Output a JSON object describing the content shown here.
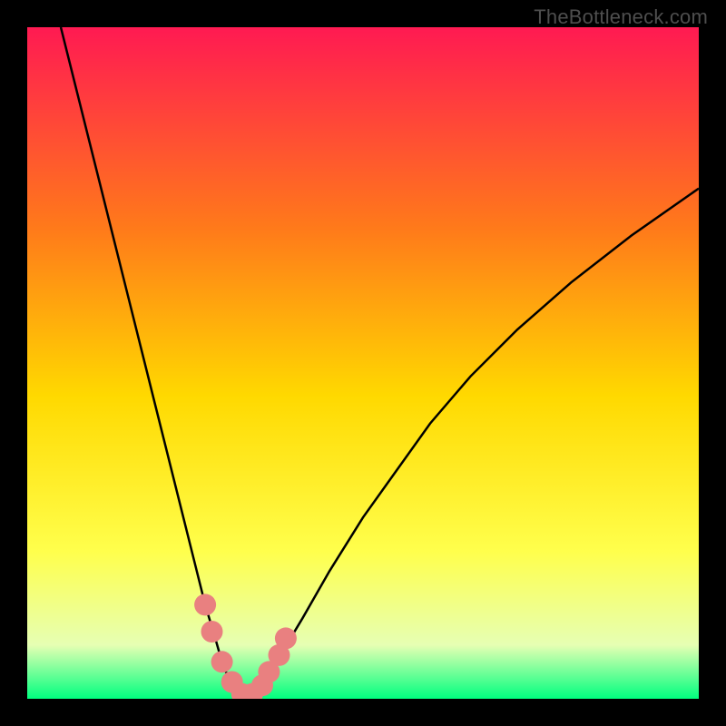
{
  "watermark": "TheBottleneck.com",
  "colors": {
    "gradient_top": "#ff1a52",
    "gradient_mid1": "#ff7a1a",
    "gradient_mid2": "#ffd900",
    "gradient_mid3": "#ffff4c",
    "gradient_mid4": "#e6ffb3",
    "gradient_bottom": "#00ff7f",
    "curve": "#000000",
    "marker": "#e98080",
    "frame": "#000000"
  },
  "chart_data": {
    "type": "line",
    "title": "",
    "xlabel": "",
    "ylabel": "",
    "xlim": [
      0,
      100
    ],
    "ylim": [
      0,
      100
    ],
    "series": [
      {
        "name": "bottleneck-curve",
        "x": [
          5,
          7,
          9,
          11,
          13,
          15,
          17,
          19,
          21,
          23,
          25,
          26.5,
          28,
          29,
          30,
          31,
          32,
          33,
          34,
          35.5,
          38,
          41,
          45,
          50,
          55,
          60,
          66,
          73,
          81,
          90,
          100
        ],
        "y": [
          100,
          92,
          84,
          76,
          68,
          60,
          52,
          44,
          36,
          28,
          20,
          14,
          9,
          5.5,
          3,
          1.5,
          0.7,
          0.7,
          1.5,
          3,
          7,
          12,
          19,
          27,
          34,
          41,
          48,
          55,
          62,
          69,
          76
        ]
      }
    ],
    "markers": {
      "name": "highlight-points",
      "x": [
        26.5,
        27.5,
        29,
        30.5,
        32,
        33.5,
        35,
        36,
        37.5,
        38.5
      ],
      "y": [
        14,
        10,
        5.5,
        2.5,
        0.7,
        0.7,
        2,
        4,
        6.5,
        9
      ]
    },
    "grid": false,
    "legend": false
  }
}
